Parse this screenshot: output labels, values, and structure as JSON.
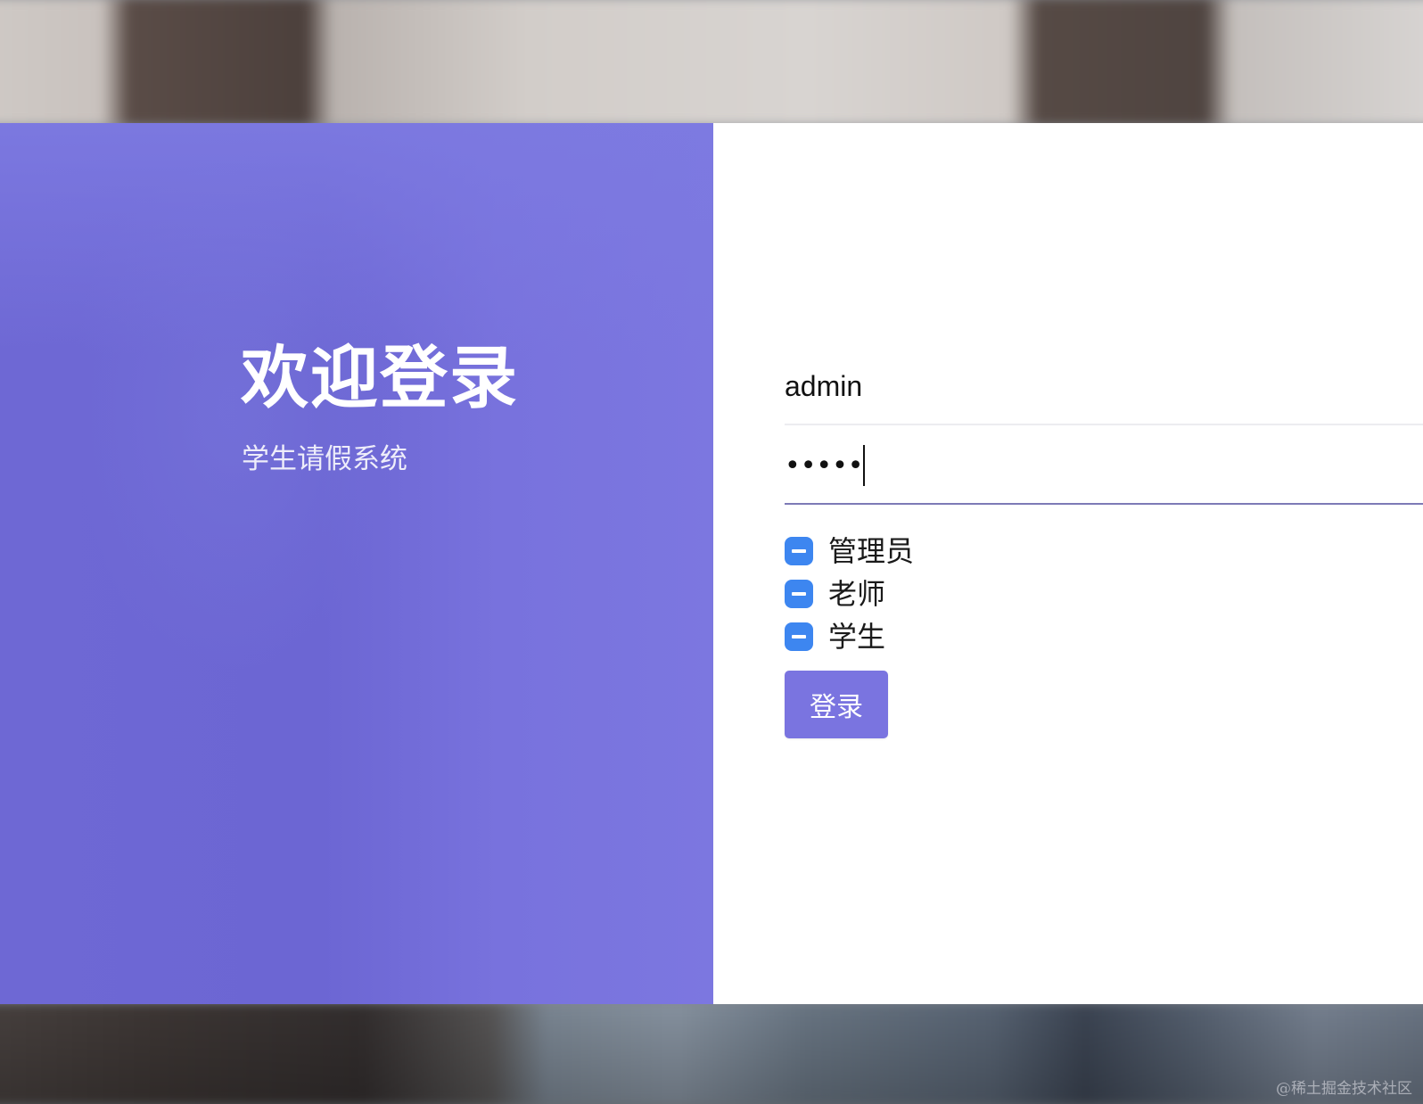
{
  "welcome": {
    "title": "欢迎登录",
    "subtitle": "学生请假系统"
  },
  "form": {
    "username": {
      "value": "admin"
    },
    "password": {
      "masked_value": "•••••"
    },
    "roles": [
      {
        "label": "管理员",
        "state": "indeterminate"
      },
      {
        "label": "老师",
        "state": "indeterminate"
      },
      {
        "label": "学生",
        "state": "indeterminate"
      }
    ],
    "submit_label": "登录"
  },
  "watermark": "@稀土掘金技术社区",
  "colors": {
    "panel_purple": "#6e68d4",
    "button_purple": "#7a74e0",
    "checkbox_blue": "#3d86f0",
    "active_underline": "#7d7ab6"
  },
  "icons": {
    "checkbox": "indeterminate-checkbox-icon"
  }
}
